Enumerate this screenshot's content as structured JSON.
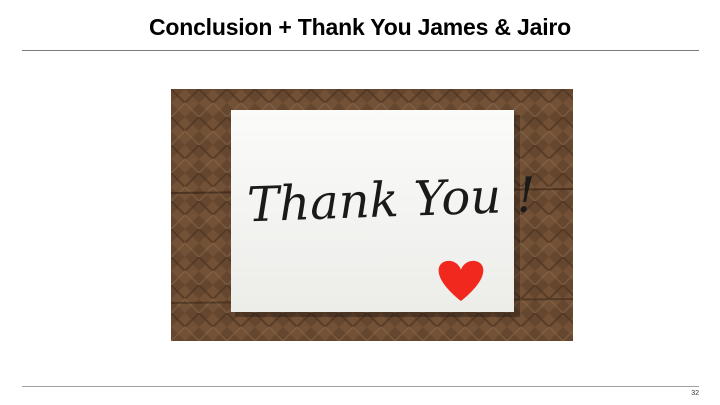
{
  "slide": {
    "title": "Conclusion + Thank You James & Jairo",
    "page_number": "32"
  },
  "image": {
    "card_text": "Thank You !",
    "icon": "heart-icon",
    "colors": {
      "wood_dark": "#5a3d26",
      "wood_light": "#8c6a4c",
      "card": "#f7f7f5",
      "heart": "#f0281e",
      "ink": "#1a1a1a"
    }
  }
}
